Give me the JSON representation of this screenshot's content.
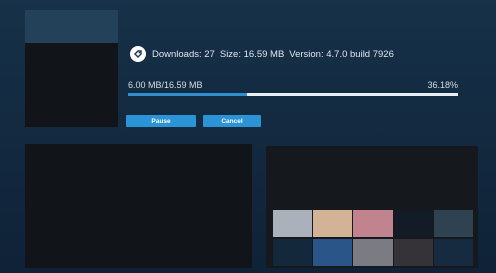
{
  "download": {
    "downloads_text": "Downloads: 27",
    "size_text": "Size: 16.59 MB",
    "version_text": "Version: 4.7.0 build 7926",
    "progress_text": "6.00 MB/16.59 MB",
    "percent_text": "36.18%",
    "progress_fraction": 0.3618
  },
  "buttons": {
    "pause_label": "Pause",
    "cancel_label": "Cancel"
  },
  "icons": {
    "badge": "tag-icon"
  },
  "colors": {
    "accent": "#2a94d6",
    "progress_fill": "#2e8ecf",
    "progress_track": "#e8eef4",
    "background": "#163149"
  },
  "swatches": [
    "#aab1ba",
    "#d3b396",
    "#c1848f",
    "#121b26",
    "#2f4252",
    "#13283b",
    "#2a5589",
    "#7b7b84",
    "#363338",
    "#162a40"
  ]
}
